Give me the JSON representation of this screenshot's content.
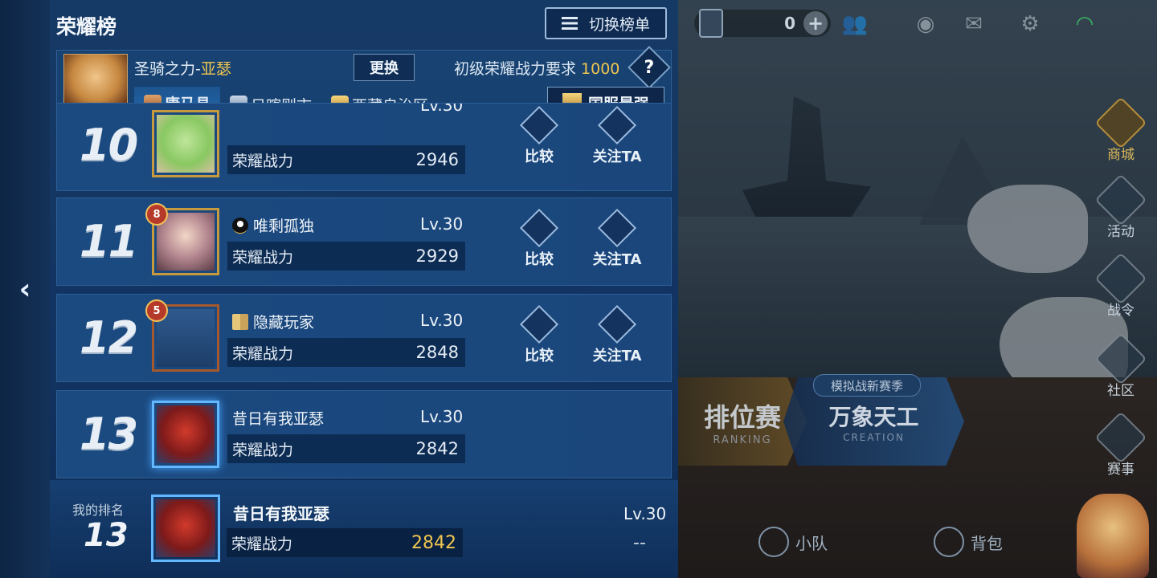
{
  "panel": {
    "title": "荣耀榜",
    "switch_label": "切换榜单",
    "hero": {
      "name_prefix": "圣骑之力-",
      "name_hero": "亚瑟",
      "change_label": "更换",
      "requirement_label": "初级荣耀战力要求",
      "requirement_value": "1000",
      "help_label": "?"
    },
    "regions": [
      {
        "label": "康马县",
        "badge": "bronze",
        "active": true
      },
      {
        "label": "日喀则市",
        "badge": "silver",
        "active": false
      },
      {
        "label": "西藏自治区",
        "badge": "gold",
        "active": false
      }
    ],
    "national_label": "国服最强"
  },
  "rows": [
    {
      "rank": "10",
      "name": "",
      "level": "Lv.30",
      "power_label": "荣耀战力",
      "power": "2946",
      "avatar": "green",
      "frame": "gold",
      "tier": "",
      "name_icon": "",
      "compare_label": "比较",
      "follow_label": "关注TA"
    },
    {
      "rank": "11",
      "name": "唯剩孤独",
      "level": "Lv.30",
      "power_label": "荣耀战力",
      "power": "2929",
      "avatar": "boy",
      "frame": "gold",
      "tier": "8",
      "name_icon": "qq-icon",
      "compare_label": "比较",
      "follow_label": "关注TA"
    },
    {
      "rank": "12",
      "name": "隐藏玩家",
      "level": "Lv.30",
      "power_label": "荣耀战力",
      "power": "2848",
      "avatar": "hidden",
      "frame": "bronze",
      "tier": "5",
      "name_icon": "book-icon",
      "compare_label": "比较",
      "follow_label": "关注TA"
    },
    {
      "rank": "13",
      "name": "昔日有我亚瑟",
      "level": "Lv.30",
      "power_label": "荣耀战力",
      "power": "2842",
      "avatar": "red",
      "frame": "blue",
      "tier": "",
      "name_icon": ""
    }
  ],
  "my_rank": {
    "label": "我的排名",
    "rank": "13",
    "name": "昔日有我亚瑟",
    "level": "Lv.30",
    "power_label": "荣耀战力",
    "power": "2842",
    "change": "--"
  },
  "topbar": {
    "coin_count": "0"
  },
  "side_menu": [
    {
      "label": "商城"
    },
    {
      "label": "活动"
    },
    {
      "label": "战令"
    },
    {
      "label": "社区"
    },
    {
      "label": "赛事"
    }
  ],
  "modes": {
    "rank_label": "排位赛",
    "rank_sub": "RANKING",
    "create_tag": "模拟战新赛季",
    "create_label": "万象天工",
    "create_sub": "CREATION"
  },
  "bottom_nav": {
    "team": "小队",
    "bag": "背包"
  }
}
